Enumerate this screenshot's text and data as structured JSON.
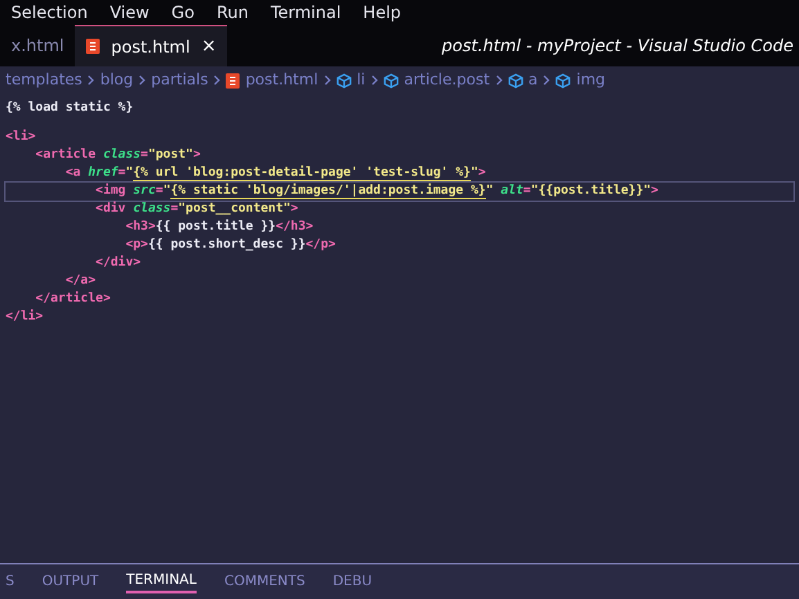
{
  "menu": [
    "Selection",
    "View",
    "Go",
    "Run",
    "Terminal",
    "Help"
  ],
  "window": {
    "title": "post.html - myProject - Visual Studio Code"
  },
  "tabs": [
    {
      "label": "x.html",
      "selected": false
    },
    {
      "label": "post.html",
      "selected": true,
      "close": "×"
    }
  ],
  "breadcrumbs": [
    {
      "label": "templates",
      "kind": "folder"
    },
    {
      "label": "blog",
      "kind": "folder"
    },
    {
      "label": "partials",
      "kind": "folder"
    },
    {
      "label": "post.html",
      "kind": "file"
    },
    {
      "label": "li",
      "kind": "symbol"
    },
    {
      "label": "article.post",
      "kind": "symbol"
    },
    {
      "label": "a",
      "kind": "symbol"
    },
    {
      "label": "img",
      "kind": "symbol"
    }
  ],
  "code_lines": [
    {
      "current": false,
      "tokens": [
        {
          "kind": "text",
          "text": "{% load static %}"
        }
      ]
    },
    {
      "current": false,
      "tokens": [
        {
          "kind": "tag",
          "text": "<li>"
        }
      ]
    },
    {
      "current": false,
      "tokens": [
        {
          "kind": "tag",
          "text": "    <article "
        },
        {
          "kind": "attr",
          "text": "class"
        },
        {
          "kind": "punct",
          "text": "="
        },
        {
          "kind": "string",
          "text": "\"post\""
        },
        {
          "kind": "tag",
          "text": ">"
        }
      ]
    },
    {
      "current": false,
      "tokens": [
        {
          "kind": "tag",
          "text": "        <a "
        },
        {
          "kind": "attr",
          "text": "href"
        },
        {
          "kind": "punct",
          "text": "="
        },
        {
          "kind": "string",
          "text": "\""
        },
        {
          "kind": "template",
          "text": "{% url 'blog:post-detail-page' 'test-slug' %}"
        },
        {
          "kind": "string",
          "text": "\""
        },
        {
          "kind": "tag",
          "text": ">"
        }
      ]
    },
    {
      "current": true,
      "tokens": [
        {
          "kind": "tag",
          "text": "            <img "
        },
        {
          "kind": "attr",
          "text": "src"
        },
        {
          "kind": "punct",
          "text": "="
        },
        {
          "kind": "string",
          "text": "\""
        },
        {
          "kind": "template",
          "text": "{% static 'blog/images/'|add:post.image %}"
        },
        {
          "kind": "string",
          "text": "\" "
        },
        {
          "kind": "attr",
          "text": "alt"
        },
        {
          "kind": "punct",
          "text": "="
        },
        {
          "kind": "string",
          "text": "\"{{post.title}}\""
        },
        {
          "kind": "tag",
          "text": ">"
        }
      ]
    },
    {
      "current": false,
      "tokens": [
        {
          "kind": "tag",
          "text": "            <div "
        },
        {
          "kind": "attr",
          "text": "class"
        },
        {
          "kind": "punct",
          "text": "="
        },
        {
          "kind": "string",
          "text": "\"post__content\""
        },
        {
          "kind": "tag",
          "text": ">"
        }
      ]
    },
    {
      "current": false,
      "tokens": [
        {
          "kind": "tag",
          "text": "                <h3>"
        },
        {
          "kind": "text",
          "text": "{{ post.title }}"
        },
        {
          "kind": "tag",
          "text": "</h3>"
        }
      ]
    },
    {
      "current": false,
      "tokens": [
        {
          "kind": "tag",
          "text": "                <p>"
        },
        {
          "kind": "text",
          "text": "{{ post.short_desc }}"
        },
        {
          "kind": "tag",
          "text": "</p>"
        }
      ]
    },
    {
      "current": false,
      "tokens": [
        {
          "kind": "tag",
          "text": "            </div>"
        }
      ]
    },
    {
      "current": false,
      "tokens": [
        {
          "kind": "tag",
          "text": "        </a>"
        }
      ]
    },
    {
      "current": false,
      "tokens": [
        {
          "kind": "tag",
          "text": "    </article>"
        }
      ]
    },
    {
      "current": false,
      "tokens": [
        {
          "kind": "tag",
          "text": "</li>"
        }
      ]
    }
  ],
  "panel_tabs": [
    {
      "label": "S",
      "selected": false
    },
    {
      "label": "OUTPUT",
      "selected": false
    },
    {
      "label": "TERMINAL",
      "selected": true
    },
    {
      "label": "COMMENTS",
      "selected": false
    },
    {
      "label": "DEBU",
      "selected": false
    }
  ]
}
